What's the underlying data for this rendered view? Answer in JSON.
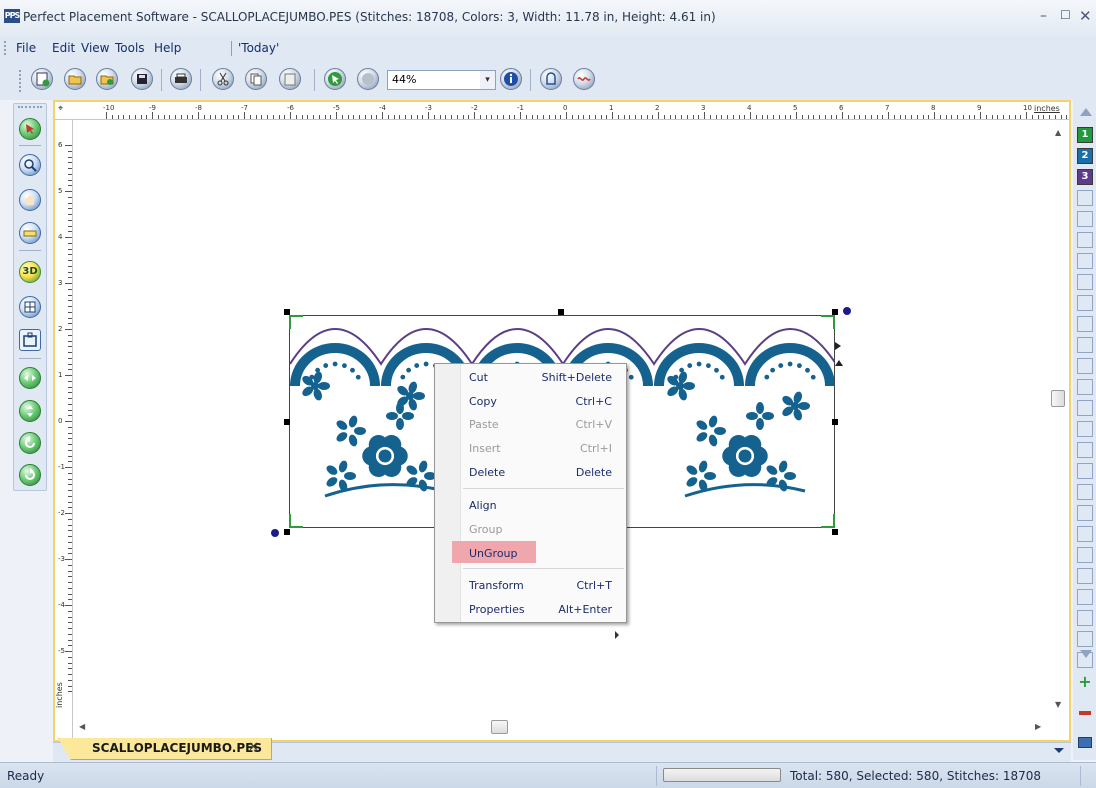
{
  "window": {
    "logo": "PPS",
    "title": "Perfect Placement Software - SCALLOPLACEJUMBO.PES (Stitches: 18708, Colors: 3, Width: 11.78 in, Height: 4.61 in)",
    "minimize": "–",
    "maximize": "☐",
    "close": "✕"
  },
  "menu": {
    "file": "File",
    "edit": "Edit",
    "view": "View",
    "tools": "Tools",
    "help": "Help",
    "today": "'Today'"
  },
  "toolbar": {
    "zoom_value": "44%",
    "zoom_arrow": "▾"
  },
  "ruler": {
    "unit_label": "inches",
    "top_ticks": [
      "-10",
      "-9",
      "-8",
      "-7",
      "-6",
      "-5",
      "-4",
      "-3",
      "-2",
      "-1",
      "0",
      "1",
      "2",
      "3",
      "4",
      "5",
      "6",
      "7",
      "8",
      "9",
      "10"
    ],
    "left_ticks": [
      "6",
      "5",
      "4",
      "3",
      "2",
      "1",
      "0",
      "-1",
      "-2",
      "-3",
      "-4",
      "-5"
    ]
  },
  "context_menu": {
    "cut": "Cut",
    "cut_shortcut": "Shift+Delete",
    "copy": "Copy",
    "copy_shortcut": "Ctrl+C",
    "paste": "Paste",
    "paste_shortcut": "Ctrl+V",
    "insert": "Insert",
    "insert_shortcut": "Ctrl+I",
    "delete": "Delete",
    "delete_shortcut": "Delete",
    "align": "Align",
    "group": "Group",
    "ungroup": "UnGroup",
    "transform": "Transform",
    "transform_shortcut": "Ctrl+T",
    "properties": "Properties",
    "properties_shortcut": "Alt+Enter"
  },
  "palette": {
    "colors": [
      {
        "index": "1",
        "color": "#1f9a3c"
      },
      {
        "index": "2",
        "color": "#1a6fa8"
      },
      {
        "index": "3",
        "color": "#5e3a8c"
      }
    ]
  },
  "design": {
    "thread_color": "#15628f",
    "outline_color": "#5b3f86"
  },
  "tab": {
    "label": "SCALLOPLACEJUMBO.PES",
    "close": "✕"
  },
  "status": {
    "ready": "Ready",
    "totals": "Total: 580, Selected: 580, Stitches: 18708"
  }
}
